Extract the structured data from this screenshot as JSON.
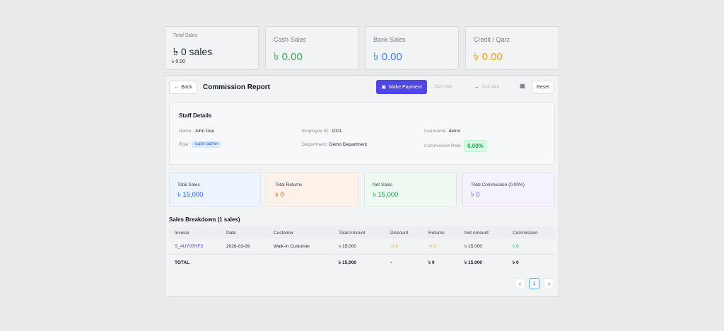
{
  "summary": {
    "total_sales": {
      "label": "Total Sales",
      "value": "৳ 0 sales",
      "sub": "৳ 0.00"
    },
    "cash_sales": {
      "label": "Cash Sales",
      "value": "৳ 0.00"
    },
    "bank_sales": {
      "label": "Bank Sales",
      "value": "৳ 0.00"
    },
    "credit": {
      "label": "Credit / Qarz",
      "value": "৳ 0.00"
    }
  },
  "header": {
    "back_label": "Back",
    "title": "Commission Report",
    "pay_label": "Make Payment",
    "start_placeholder": "Start date",
    "end_placeholder": "End date",
    "reset_label": "Reset"
  },
  "staff": {
    "title": "Staff Details",
    "name_label": "Name:",
    "name": "John Doe",
    "employee_id_label": "Employee ID:",
    "employee_id": "1001",
    "username_label": "Username:",
    "username": "demo",
    "role_label": "Role:",
    "role": "super-admin",
    "department_label": "Department:",
    "department": "Demo Department",
    "rate_label": "Commission Rate:",
    "rate": "0.00%"
  },
  "stats": [
    {
      "label": "Total Sales",
      "value": "৳ 15,000"
    },
    {
      "label": "Total Returns",
      "value": "৳ 0"
    },
    {
      "label": "Net Sales",
      "value": "৳ 15,000"
    },
    {
      "label": "Total Commission (0.00%)",
      "value": "৳ 0"
    }
  ],
  "breakdown": {
    "title": "Sales Breakdown (1 sales)",
    "columns": [
      "Invoice",
      "Date",
      "Customer",
      "Total Amount",
      "Discount",
      "Returns",
      "Net Amount",
      "Commission"
    ],
    "rows": [
      {
        "invoice": "S_4UY07HF3",
        "date": "2026-03-09",
        "customer": "Walk-in Customer",
        "total": "৳ 15,000",
        "discount": "-৳ 0",
        "returns": "-৳ 0",
        "net": "৳ 15,000",
        "commission": "৳ 0"
      }
    ],
    "total_row": {
      "label": "TOTAL",
      "total": "৳ 15,000",
      "discount": "-",
      "returns": "৳ 0",
      "net": "৳ 15,000",
      "commission": "৳ 0"
    }
  },
  "pagination": {
    "prev": "‹",
    "current": "1",
    "next": "›"
  }
}
